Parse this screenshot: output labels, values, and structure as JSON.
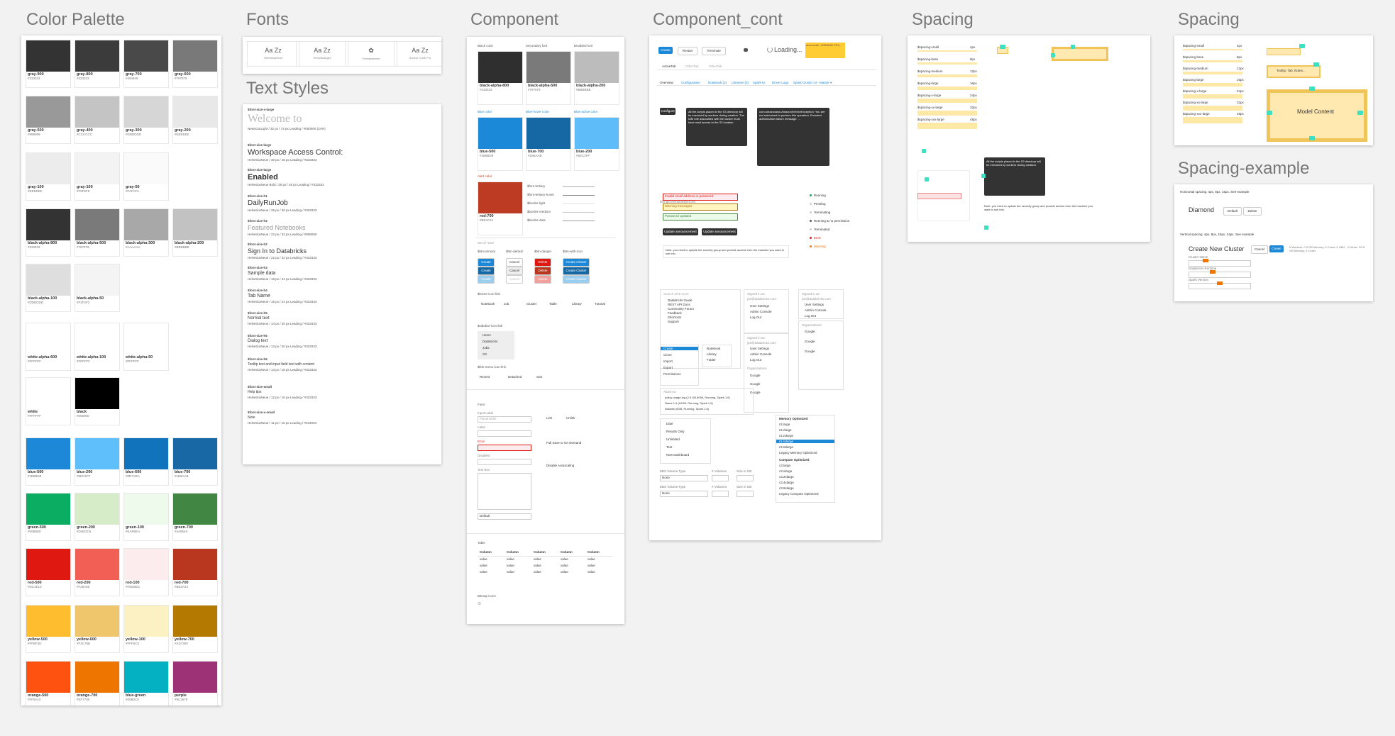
{
  "boards": {
    "palette": {
      "title": "Color Palette"
    },
    "fonts": {
      "title": "Fonts"
    },
    "textstyles": {
      "title": "Text Styles"
    },
    "component": {
      "title": "Component"
    },
    "component_cont": {
      "title": "Component_cont"
    },
    "spacing1": {
      "title": "Spacing"
    },
    "spacing2": {
      "title": "Spacing"
    },
    "spacing_example": {
      "title": "Spacing-example"
    }
  },
  "palette": [
    {
      "name": "gray-900",
      "hex": "#333333",
      "color": "#333333"
    },
    {
      "name": "gray-800",
      "hex": "#333333",
      "color": "#3b3b3b"
    },
    {
      "name": "gray-700",
      "hex": "#494949",
      "color": "#494949"
    },
    {
      "name": "gray-600",
      "hex": "#797979",
      "color": "#797979"
    },
    {
      "name": "gray-500",
      "hex": "#999999",
      "color": "#999999"
    },
    {
      "name": "gray-400",
      "hex": "#CCCCCC",
      "color": "#c4c4c4"
    },
    {
      "name": "gray-300",
      "hex": "#DDDDDD",
      "color": "#d6d6d6"
    },
    {
      "name": "gray-200",
      "hex": "#EEEEEE",
      "color": "#e8e8e8"
    },
    {
      "name": "gray-100",
      "hex": "#EEEEEE",
      "color": "#ececec"
    },
    {
      "name": "gray-100",
      "hex": "#F5F5F5",
      "color": "#f3f3f3"
    },
    {
      "name": "gray-50",
      "hex": "#FAFAFA",
      "color": "#fafafa"
    },
    {
      "name": "black-alpha-800",
      "hex": "#333333",
      "color": "#333333"
    },
    {
      "name": "black-alpha-500",
      "hex": "#797979",
      "color": "#7a7a7a"
    },
    {
      "name": "black-alpha-300",
      "hex": "#AAAAAA",
      "color": "#a8a8a8"
    },
    {
      "name": "black-alpha-200",
      "hex": "#BBBBBB",
      "color": "#c2c2c2"
    },
    {
      "name": "black-alpha-100",
      "hex": "#DDDDDD",
      "color": "#dedede"
    },
    {
      "name": "black-alpha-50",
      "hex": "#F2F2F2",
      "color": "#f4f4f4"
    },
    {
      "name": "white-alpha-600",
      "hex": "#FFFFFF",
      "color": "#ffffff"
    },
    {
      "name": "white-alpha-100",
      "hex": "#FFFFFF",
      "color": "#ffffff"
    },
    {
      "name": "white-alpha-50",
      "hex": "#FFFFFF",
      "color": "#ffffff"
    },
    {
      "name": "white",
      "hex": "#FFFFFF",
      "color": "#ffffff"
    },
    {
      "name": "black",
      "hex": "#000000",
      "color": "#000000"
    },
    {
      "name": "blue-500",
      "hex": "#1B8BD8",
      "color": "#1e88d8"
    },
    {
      "name": "blue-200",
      "hex": "#5EC2FF",
      "color": "#5fbffa"
    },
    {
      "name": "blue-600",
      "hex": "#0D7ABA",
      "color": "#1273bd"
    },
    {
      "name": "blue-700",
      "hex": "#1B6AAB",
      "color": "#1868a5"
    },
    {
      "name": "green-500",
      "hex": "#00B06D",
      "color": "#0aad62"
    },
    {
      "name": "green-200",
      "hex": "#D4EDC6",
      "color": "#d6ecc9"
    },
    {
      "name": "green-100",
      "hex": "#EAFBEA",
      "color": "#eefbec"
    },
    {
      "name": "green-700",
      "hex": "#4A8548",
      "color": "#418743"
    },
    {
      "name": "red-500",
      "hex": "#DC1E10",
      "color": "#df1812"
    },
    {
      "name": "red-200",
      "hex": "#F25A50",
      "color": "#f26055"
    },
    {
      "name": "red-100",
      "hex": "#FEEBEC",
      "color": "#fdecee"
    },
    {
      "name": "red-700",
      "hex": "#BE3A24",
      "color": "#b9361f"
    },
    {
      "name": "yellow-500",
      "hex": "#FFBF3D",
      "color": "#fdbd2f"
    },
    {
      "name": "yellow-600",
      "hex": "#F4C76B",
      "color": "#efc66c"
    },
    {
      "name": "yellow-100",
      "hex": "#FFF5C0",
      "color": "#fbf1c3"
    },
    {
      "name": "yellow-700",
      "hex": "#AD7300",
      "color": "#b37900"
    },
    {
      "name": "orange-500",
      "hex": "#FF5A10",
      "color": "#fe5210"
    },
    {
      "name": "orange-700",
      "hex": "#EF7700",
      "color": "#ee7500"
    },
    {
      "name": "blue-green",
      "hex": "#00B0C0",
      "color": "#03b1c3"
    },
    {
      "name": "purple",
      "hex": "#9C3579",
      "color": "#9d3276"
    }
  ],
  "fonts": [
    {
      "sample": "Aa Zz",
      "name": "HelveticaNeue"
    },
    {
      "sample": "Aa Zz",
      "name": "HelveticaLight"
    },
    {
      "sample": "✿",
      "name": "Fontawesome"
    },
    {
      "sample": "Aa Zz",
      "name": "Source Code Pro"
    }
  ],
  "text_styles": [
    {
      "tag": "$font-size-x-large",
      "sample": "Welcome to",
      "desc": "NewsGotLight / 32 px / 72 px Leading / #000000 (24%)"
    },
    {
      "tag": "$font-size-large",
      "sample": "Workspace Access Control:",
      "desc": "HelveticaNeue / 30 px / 48 px Leading / #333333"
    },
    {
      "tag": "$font-size-large",
      "sample": "Enabled",
      "desc": "HelveticaNeue Bold / 30 px / 48 px Leading / #333333"
    },
    {
      "tag": "$font-size-h1",
      "sample": "DailyRunJob",
      "desc": "HelveticaNeue / 26 px / 36 px Leading / #333333"
    },
    {
      "tag": "$font-size-h2",
      "sample": "Featured Notebooks",
      "desc": "HelveticaNeue / 22 px / 32 px Leading / #808080"
    },
    {
      "tag": "$font-size-h2",
      "sample": "Sign In to Databricks",
      "desc": "HelveticaNeue / 22 px / 32 px Leading / #333333"
    },
    {
      "tag": "$font-size-h3",
      "sample": "Sample data",
      "desc": "HelveticaNeue / 18 px / 24 px Leading / #333333"
    },
    {
      "tag": "$font-size-h4",
      "sample": "Tab Name",
      "desc": "HelveticaNeue / 16 px / 24 px Leading / #333333"
    },
    {
      "tag": "$font-size-h5",
      "sample": "Normal text",
      "desc": "HelveticaNeue / 14 px / 20 px Leading / #333333"
    },
    {
      "tag": "$font-size-h6",
      "sample": "Dialog text",
      "desc": "HelveticaNeue / 13 px / 20 px Leading / #333333"
    },
    {
      "tag": "$font-size-h6",
      "sample": "Tooltip text and input field text with content",
      "desc": "HelveticaNeue / 13 px / 18 px Leading / #333333"
    },
    {
      "tag": "$font-size-small",
      "sample": "Help tips",
      "desc": "HelveticaNeue / 12 px / 16 px Leading / #333333"
    },
    {
      "tag": "$font-size-x-small",
      "sample": "Note",
      "desc": "HelveticaNeue / 11 px / 16 px Leading / #404040"
    }
  ],
  "component": {
    "color_headers": [
      "Black color",
      "Secondary font",
      "Disabled font"
    ],
    "color_swatches": [
      {
        "name": "black-alpha-800",
        "hex": "#333333",
        "color": "#2f2f2f"
      },
      {
        "name": "black-alpha-500",
        "hex": "#797979",
        "color": "#7a7a7a"
      },
      {
        "name": "black-alpha-200",
        "hex": "#BBBBBB",
        "color": "#bcbcbc"
      },
      {
        "name": "blue-500",
        "hex": "#1B8BD8",
        "color": "#1b88d8"
      },
      {
        "name": "blue-700",
        "hex": "#1B6AAB",
        "color": "#1568a4"
      },
      {
        "name": "blue-200",
        "hex": "#5EC2FF",
        "color": "#5ebcf8"
      },
      {
        "name": "red-700",
        "hex": "#BE3A24",
        "color": "#bd3a23"
      }
    ],
    "blue_headers": [
      "Blue color",
      "Blue-hover color",
      "Blue-active color"
    ],
    "alert_header": "Alert color",
    "borders": [
      "$font-tertiary",
      "$font-tertiary-hover",
      "$border-light",
      "$border-medium",
      "$border-dark"
    ],
    "buttons_header": "Set of 'Your'",
    "button_groups": [
      "$btn-primary",
      "$btn-default",
      "$btn-danger",
      "$btn-with-icon"
    ],
    "button_labels": {
      "create": "Create",
      "cancel": "Cancel",
      "delete": "Delete",
      "create_cluster": "Create Cluster"
    },
    "icon_link_header": "$home-icon-link",
    "icon_links": [
      "Notebook",
      "Job",
      "Cluster",
      "Table",
      "Library",
      "Tutorial"
    ],
    "sidebar_header": "$sidebar-icon-link",
    "sidebar_items": [
      "Users",
      "Databricks",
      "Jobs",
      "Git"
    ],
    "menu_header": "$link-menu-icon-link",
    "menu_items": [
      "Recent",
      "Detached",
      "Sort"
    ],
    "form_header": "Form",
    "form_labels": [
      "Input Label",
      "Label",
      "Error",
      "Disabled",
      "Text Box"
    ],
    "placeholder": "Placeholder",
    "radio_labels": [
      "Link",
      "Unlink"
    ],
    "checkbox_labels": [
      "Full Save to On Demand",
      "Disable Autoscaling"
    ],
    "select_value": "Default",
    "table_header": "Table",
    "table_columns": [
      "Column",
      "Column",
      "Column",
      "Column",
      "Column"
    ],
    "table_cells": [
      "value",
      "value",
      "value",
      "value",
      "value"
    ],
    "bitmap_header": "Bitmap icons"
  },
  "component_cont": {
    "top_buttons": [
      "Create",
      "Restart",
      "Terminate"
    ],
    "loading": "Loading...",
    "warning": "auto-scale: 4GB/8GB CPU...",
    "tabs": [
      "ActiveTab",
      "OtherTab",
      "OtherTab"
    ],
    "subtabs": [
      "Overview",
      "Configuration",
      "Notebook (3)",
      "Libraries (2)",
      "Spark UI",
      "Driver Logs",
      "Spark Cluster UI - Master ▾"
    ],
    "configure_label": "Configure",
    "tooltip1": "All the scripts placed in the S3 directory will be executed by workers during creation. The IAM role associated with the cluster must have read access to the S3 location.",
    "tooltip2": "com.amazonaws.AmazonServiceException: You are not authorized to perform this operation. Encoded authorization failure message: ...",
    "status_section": "$fontprocessedStyleCSS",
    "messages": [
      "Invalid email address or password.",
      "Warning messages",
      "Password updated"
    ],
    "update_buttons": [
      "Update announcement",
      "Update announcement"
    ],
    "status_items": [
      "Running",
      "Pending",
      "Terminating",
      "Running & no permission",
      "Terminated",
      "Error",
      "Warning"
    ],
    "note": "Note: you need to update the security group and provide access from the machine you want to ssh into.",
    "search_placeholder": "Search all & more",
    "search_results": [
      "Databricks Guide",
      "REST API Docs",
      "Community Forum",
      "Feedback",
      "Shortcuts",
      "Support"
    ],
    "menu_create": [
      "Create",
      "Clone",
      "Import",
      "Export",
      "Permissions"
    ],
    "menu_sub": [
      "Notebook",
      "Library",
      "Folder"
    ],
    "signed_in": "Signed in as",
    "email": "joe@databricks.com",
    "account_menu": [
      "User Settings",
      "Admin Console",
      "Log Out"
    ],
    "orgs_header": "Organizations",
    "orgs": [
      "Google",
      "Google",
      "Google"
    ],
    "attach_to": "Attach to",
    "clusters": [
      "policy-usage-log (2.9 GB 8096, Running, Spark 1.6)",
      "Name 1.6 (10GB, Running, Spark 1.6)",
      "Notable (8GB, Running, Spark 1.6)"
    ],
    "sort_menu": [
      "Date",
      "Results Only",
      "Unlimited",
      "Text",
      "New Dashboard"
    ],
    "ebs_labels": [
      "EBS Volume Type",
      "# Volumes",
      "Size in GB"
    ],
    "ebs_value": "None",
    "memory_header": "Memory Optimized",
    "instances": [
      "r3.large",
      "r3.xlarge",
      "r3.2xlarge",
      "r3.4xlarge",
      "r3.8xlarge",
      "Legacy Memory Optimized"
    ],
    "compute_header": "Compute Optimized",
    "compute_instances": [
      "c3.large",
      "c3.xlarge",
      "c3.2xlarge",
      "c3.4xlarge",
      "c3.8xlarge",
      "Legacy Compute Optimized"
    ]
  },
  "spacing": {
    "rows": [
      {
        "name": "$spacing-small",
        "val": "4px"
      },
      {
        "name": "$spacing-base",
        "val": "8px"
      },
      {
        "name": "$spacing-medium",
        "val": "12px"
      },
      {
        "name": "$spacing-large",
        "val": "16px"
      },
      {
        "name": "$spacing-x-large",
        "val": "24px"
      },
      {
        "name": "$spacing-xx-large",
        "val": "32px"
      },
      {
        "name": "$spacing-xxx-large",
        "val": "48px"
      }
    ],
    "tooltip": "All the scripts placed in the S3 directory will be executed by workers during creation.",
    "note": "Note: you need to update the security group and provide access from the machine you want to ssh into."
  },
  "spacing2": {
    "tooltip_label": "Tooltip, Tab, Notes...",
    "model_content": "Model Content"
  },
  "spacing_example": {
    "horizontal": "Horizontal spacing: 4px, 8px, 16px. See example",
    "diamond": "Diamond",
    "pill_buttons": [
      "Default",
      "Delete"
    ],
    "vertical": "Vertical spacing: 4px, 8px, 16px, 24px. See example",
    "cluster_title": "Create New Cluster",
    "cancel": "Cancel",
    "create": "Create",
    "desc": "0 Workers: 0.0 GB Memory, 0 Cores, 0 DBU · 1 Driver: 30.5 GB Memory, 4 Cores",
    "labels": [
      "Cluster Name",
      "Databricks Runtime",
      "Spark Version"
    ]
  }
}
